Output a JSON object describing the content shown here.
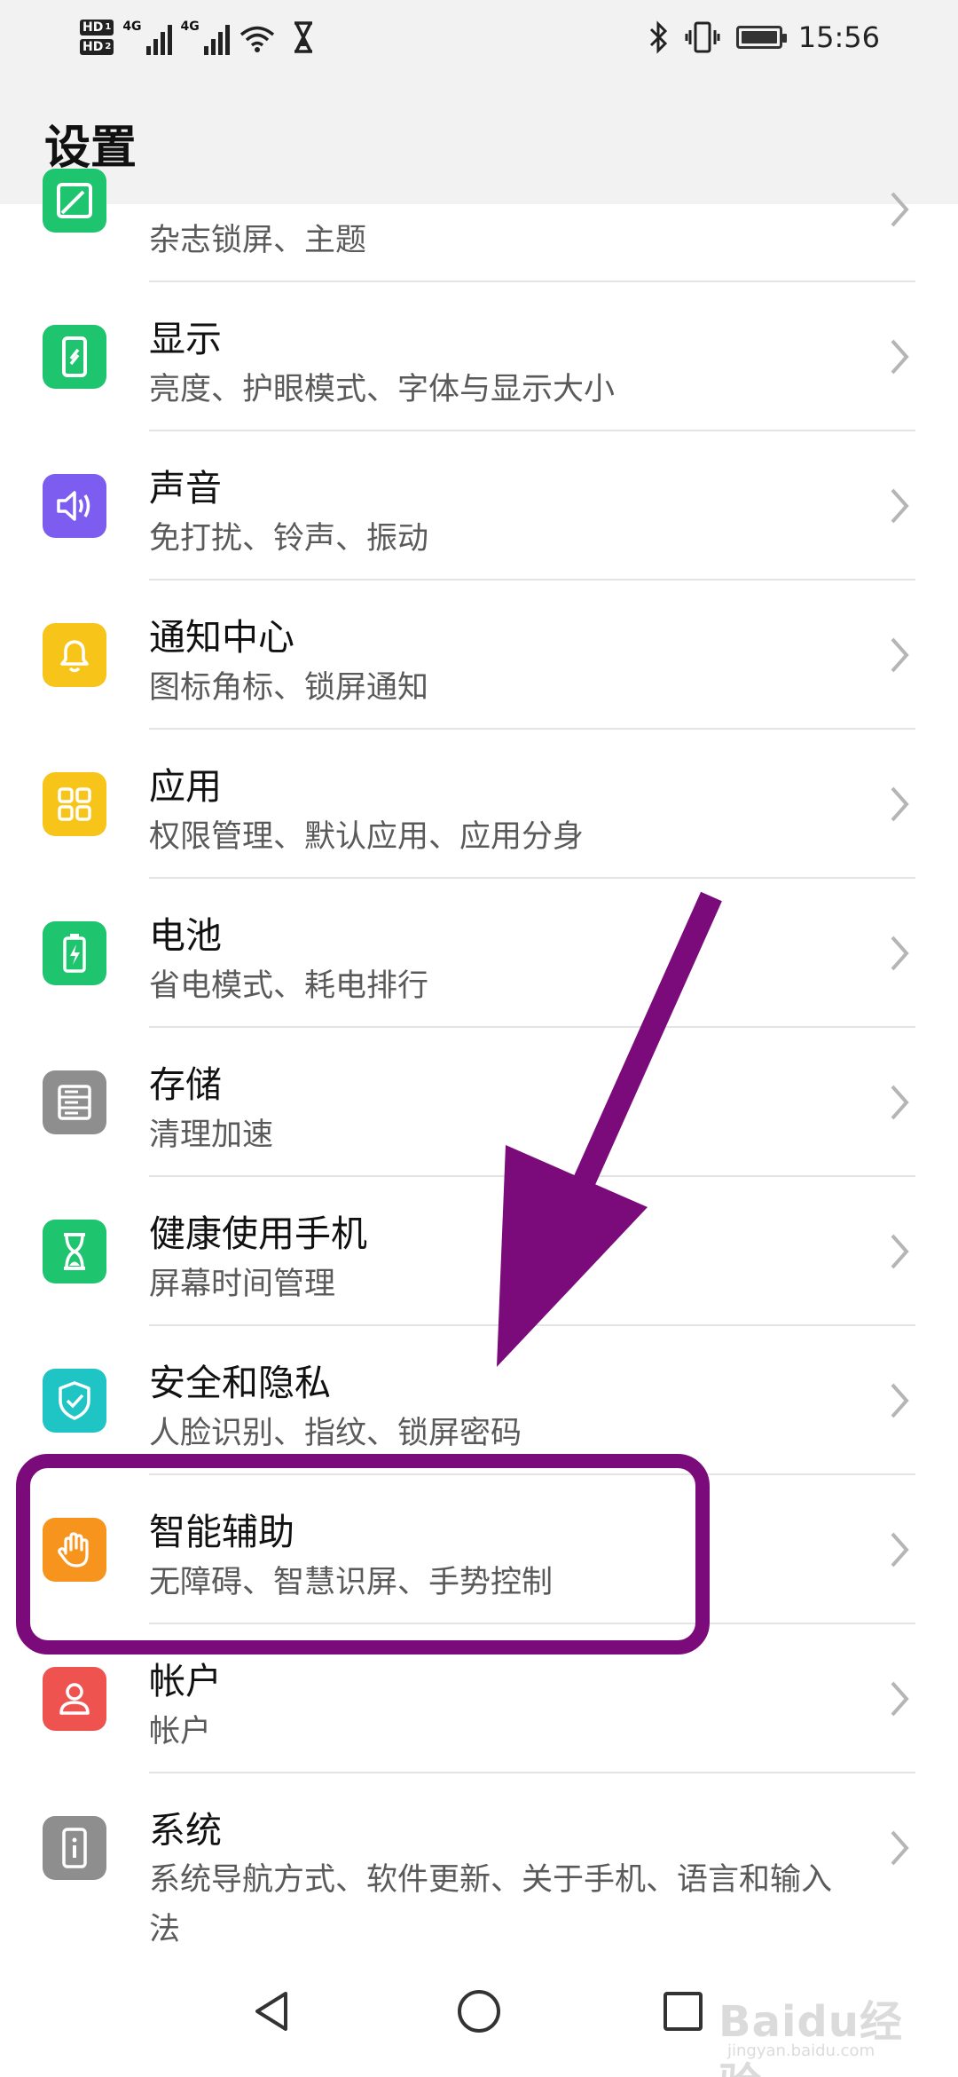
{
  "status_bar": {
    "sim1": "HD",
    "sim1_num": "1",
    "sim2": "HD",
    "sim2_num": "2",
    "net1": "4G",
    "net2": "4G",
    "time": "15:56",
    "icons": [
      "wifi-icon",
      "hourglass-icon",
      "bluetooth-icon",
      "vibrate-icon",
      "battery-icon"
    ]
  },
  "header": {
    "title": "设置"
  },
  "settings": [
    {
      "title": "",
      "subtitle": "杂志锁屏、主题",
      "icon": "wallpaper-icon",
      "color": "#1fc46f"
    },
    {
      "title": "显示",
      "subtitle": "亮度、护眼模式、字体与显示大小",
      "icon": "display-icon",
      "color": "#1fc46f"
    },
    {
      "title": "声音",
      "subtitle": "免打扰、铃声、振动",
      "icon": "speaker-icon",
      "color": "#7d5cf0"
    },
    {
      "title": "通知中心",
      "subtitle": "图标角标、锁屏通知",
      "icon": "bell-icon",
      "color": "#f7c51a"
    },
    {
      "title": "应用",
      "subtitle": "权限管理、默认应用、应用分身",
      "icon": "apps-grid-icon",
      "color": "#f7c51a"
    },
    {
      "title": "电池",
      "subtitle": "省电模式、耗电排行",
      "icon": "battery-charge-icon",
      "color": "#1fc46f"
    },
    {
      "title": "存储",
      "subtitle": "清理加速",
      "icon": "storage-icon",
      "color": "#8e8e8e"
    },
    {
      "title": "健康使用手机",
      "subtitle": "屏幕时间管理",
      "icon": "hourglass-icon",
      "color": "#1fc46f"
    },
    {
      "title": "安全和隐私",
      "subtitle": "人脸识别、指纹、锁屏密码",
      "icon": "shield-check-icon",
      "color": "#1fc4c4"
    },
    {
      "title": "智能辅助",
      "subtitle": "无障碍、智慧识屏、手势控制",
      "icon": "hand-icon",
      "color": "#f7941d"
    },
    {
      "title": "帐户",
      "subtitle": "帐户",
      "icon": "person-icon",
      "color": "#ef5350"
    },
    {
      "title": "系统",
      "subtitle": "系统导航方式、软件更新、关于手机、语言和输入法",
      "icon": "phone-info-icon",
      "color": "#8e8e8e"
    }
  ],
  "annotations": {
    "arrow_color": "#7b0a7b",
    "box_color": "#7b0a7b"
  },
  "nav": {
    "icons": [
      "back-icon",
      "home-icon",
      "recents-icon"
    ]
  },
  "watermark": {
    "brand": "Baidu经验",
    "url": "jingyan.baidu.com"
  }
}
